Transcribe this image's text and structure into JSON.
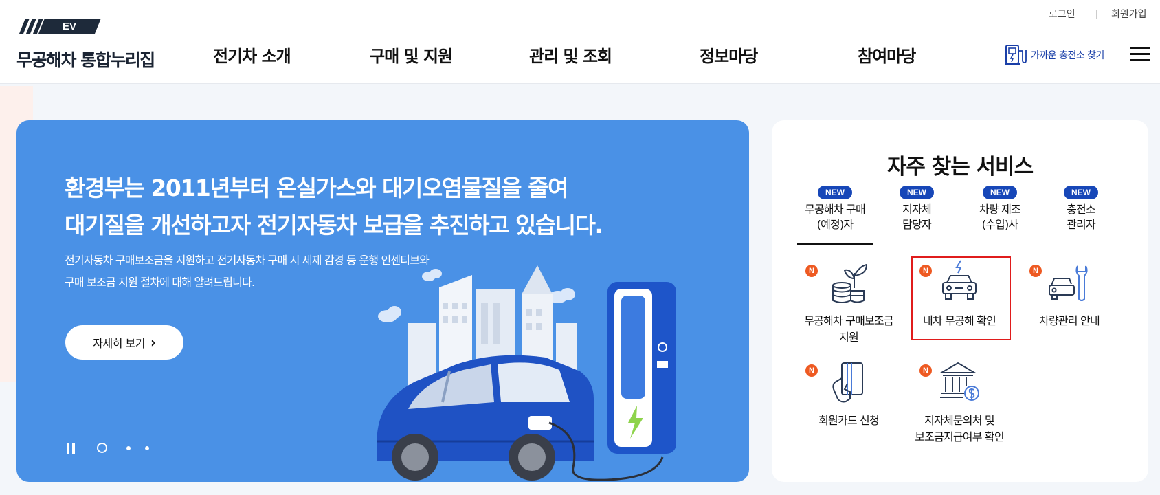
{
  "header": {
    "logo_badge": "EV",
    "logo_name": "무공해차 통합누리집",
    "nav": [
      "전기차 소개",
      "구매 및 지원",
      "관리 및 조회",
      "정보마당",
      "참여마당"
    ],
    "util": {
      "login": "로그인",
      "signup": "회원가입"
    },
    "nearby_label": "가까운 충전소 찾기"
  },
  "banner": {
    "title_line1": "환경부는 2011년부터 온실가스와 대기오염물질을 줄여",
    "title_line2": "대기질을 개선하고자 전기자동차 보급을 추진하고 있습니다.",
    "desc_line1": "전기자동차 구매보조금을 지원하고 전기자동차 구매 시 세제 감경 등 운행 인센티브와",
    "desc_line2": "구매 보조금 지원 절차에 대해 알려드립니다.",
    "more_label": "자세히 보기",
    "more_arrow": "›"
  },
  "services": {
    "title": "자주 찾는 서비스",
    "new_badge": "NEW",
    "tabs": [
      {
        "line1": "무공해차 구매",
        "line2": "(예정)자",
        "active": true
      },
      {
        "line1": "지자체",
        "line2": "담당자"
      },
      {
        "line1": "차량 제조",
        "line2": "(수입)사"
      },
      {
        "line1": "충전소",
        "line2": "관리자"
      }
    ],
    "n_badge": "N",
    "items": [
      {
        "line1": "무공해차 구매보조금",
        "line2": "지원",
        "icon": "coins-plant-icon"
      },
      {
        "line1": "내차 무공해 확인",
        "line2": "",
        "icon": "ev-car-icon",
        "highlighted": true
      },
      {
        "line1": "차량관리 안내",
        "line2": "",
        "icon": "car-wrench-icon"
      },
      {
        "line1": "회원카드 신청",
        "line2": "",
        "icon": "card-hand-icon"
      },
      {
        "line1": "지자체문의처 및",
        "line2": "보조금지급여부 확인",
        "icon": "bank-dollar-icon"
      }
    ]
  },
  "colors": {
    "banner": "#4a91e6",
    "badge": "#1747b8",
    "n_badge": "#ee5a22",
    "highlight": "#e01c1c"
  }
}
